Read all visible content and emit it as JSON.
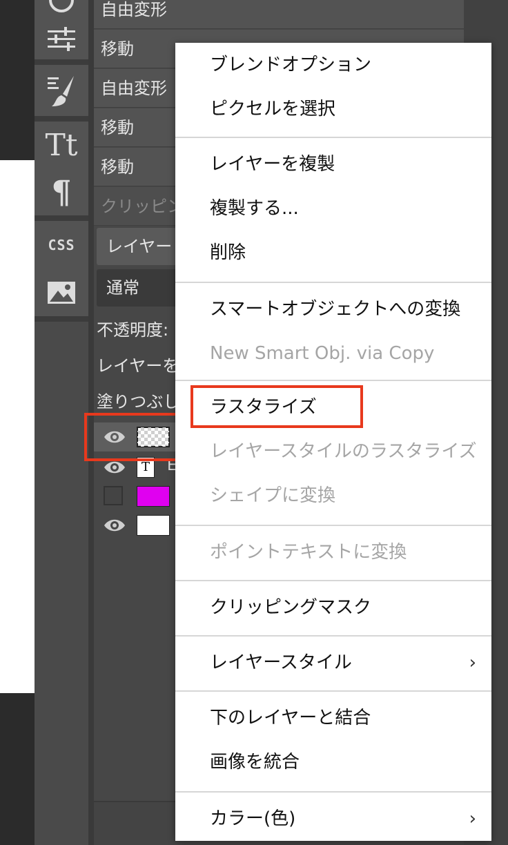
{
  "history": [
    {
      "label": "自由変形",
      "dim": false
    },
    {
      "label": "移動",
      "dim": false
    },
    {
      "label": "自由変形",
      "dim": false
    },
    {
      "label": "移動",
      "dim": false
    },
    {
      "label": "移動",
      "dim": false
    },
    {
      "label": "クリッピング",
      "dim": true
    }
  ],
  "tools": {
    "text_tool": "Tt",
    "paragraph": "¶",
    "css": "CSS"
  },
  "layers_panel": {
    "header": "レイヤー",
    "blend_mode": "通常",
    "opacity_label": "不透明度:",
    "lock_label": "レイヤーを",
    "fill_label": "塗りつぶし",
    "text_thumb": "T",
    "layer_name_2": "E"
  },
  "menu": {
    "groups": [
      [
        {
          "label": "ブレンドオプション",
          "disabled": false
        },
        {
          "label": "ピクセルを選択",
          "disabled": false
        }
      ],
      [
        {
          "label": "レイヤーを複製",
          "disabled": false
        },
        {
          "label": "複製する...",
          "disabled": false
        },
        {
          "label": "削除",
          "disabled": false
        }
      ],
      [
        {
          "label": "スマートオブジェクトへの変換",
          "disabled": false
        },
        {
          "label": "New Smart Obj. via Copy",
          "disabled": true
        }
      ],
      [
        {
          "label": "ラスタライズ",
          "disabled": false
        },
        {
          "label": "レイヤースタイルのラスタライズ",
          "disabled": true
        },
        {
          "label": "シェイプに変換",
          "disabled": true
        }
      ],
      [
        {
          "label": "ポイントテキストに変換",
          "disabled": true
        }
      ],
      [
        {
          "label": "クリッピングマスク",
          "disabled": false
        }
      ],
      [
        {
          "label": "レイヤースタイル",
          "disabled": false,
          "submenu": true
        }
      ],
      [
        {
          "label": "下のレイヤーと結合",
          "disabled": false
        },
        {
          "label": "画像を統合",
          "disabled": false
        }
      ],
      [
        {
          "label": "カラー(色)",
          "disabled": false,
          "submenu": true
        }
      ]
    ],
    "submenu_glyph": "›"
  },
  "colors": {
    "highlight": "#e8391d",
    "magenta_layer": "#e000f0"
  }
}
